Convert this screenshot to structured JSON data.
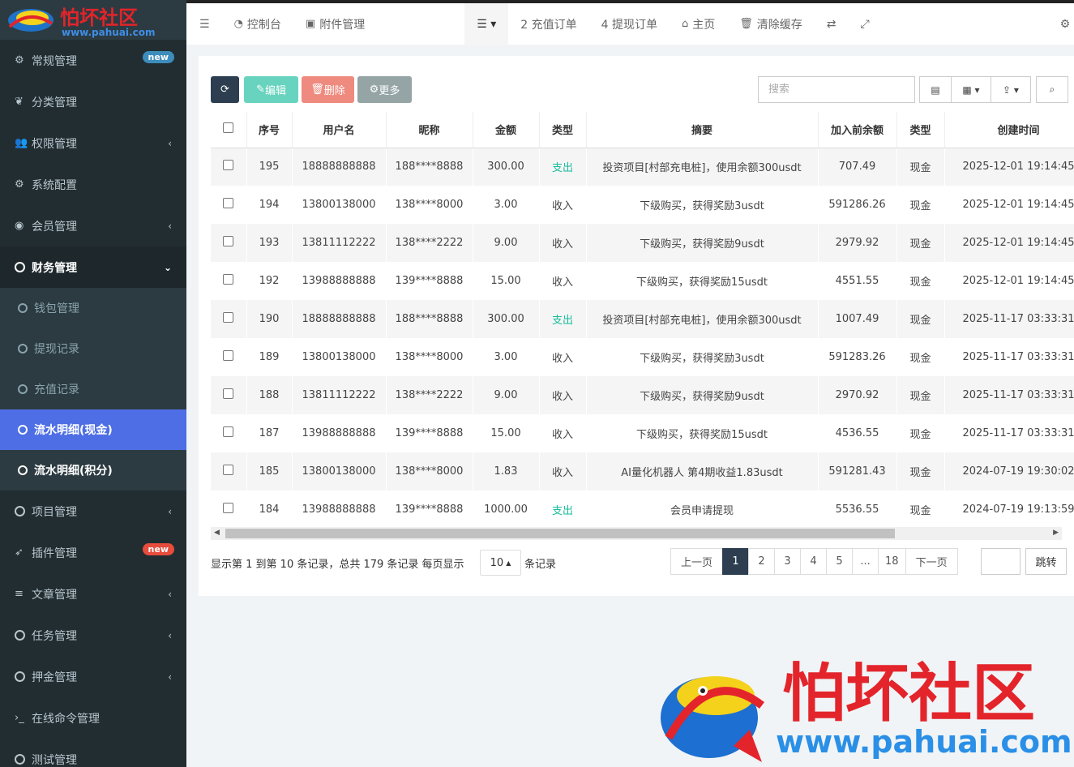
{
  "sidebar": {
    "logo": {
      "text": "怕坏社区",
      "url": "www.pahuai.com"
    },
    "items": [
      {
        "label": "常规管理",
        "icon": "cogs-icon",
        "badge": "new"
      },
      {
        "label": "分类管理",
        "icon": "leaf-icon"
      },
      {
        "label": "权限管理",
        "icon": "group-icon"
      },
      {
        "label": "系统配置",
        "icon": "cog-icon"
      },
      {
        "label": "会员管理",
        "icon": "user-circle-icon"
      },
      {
        "label": "财务管理",
        "icon": "circle-icon"
      },
      {
        "label": "项目管理",
        "icon": "circle-icon"
      },
      {
        "label": "插件管理",
        "icon": "rocket-icon",
        "badge": "new"
      },
      {
        "label": "文章管理",
        "icon": "list-icon"
      },
      {
        "label": "任务管理",
        "icon": "circle-icon"
      },
      {
        "label": "押金管理",
        "icon": "circle-icon"
      },
      {
        "label": "在线命令管理",
        "icon": "terminal-icon"
      },
      {
        "label": "测试管理",
        "icon": "circle-icon"
      }
    ],
    "finance_sub": [
      "钱包管理",
      "提现记录",
      "充值记录",
      "流水明细(现金)",
      "流水明细(积分)"
    ]
  },
  "topbar": {
    "dashboard": "控制台",
    "attachments": "附件管理",
    "recharge": "2 充值订单",
    "withdraw": "4 提现订单",
    "home": "主页",
    "clear_cache": "清除缓存"
  },
  "toolbar": {
    "edit": "编辑",
    "delete": "删除",
    "more": "更多",
    "search_placeholder": "搜索"
  },
  "table": {
    "headers": [
      "序号",
      "用户名",
      "昵称",
      "金额",
      "类型",
      "摘要",
      "加入前余额",
      "类型",
      "创建时间"
    ],
    "rows": [
      [
        "195",
        "18888888888",
        "188****8888",
        "300.00",
        "支出",
        "投资项目[村部充电桩]，使用余额300usdt",
        "707.49",
        "现金",
        "2025-12-01 19:14:45"
      ],
      [
        "194",
        "13800138000",
        "138****8000",
        "3.00",
        "收入",
        "下级购买，获得奖励3usdt",
        "591286.26",
        "现金",
        "2025-12-01 19:14:45"
      ],
      [
        "193",
        "13811112222",
        "138****2222",
        "9.00",
        "收入",
        "下级购买，获得奖励9usdt",
        "2979.92",
        "现金",
        "2025-12-01 19:14:45"
      ],
      [
        "192",
        "13988888888",
        "139****8888",
        "15.00",
        "收入",
        "下级购买，获得奖励15usdt",
        "4551.55",
        "现金",
        "2025-12-01 19:14:45"
      ],
      [
        "190",
        "18888888888",
        "188****8888",
        "300.00",
        "支出",
        "投资项目[村部充电桩]，使用余额300usdt",
        "1007.49",
        "现金",
        "2025-11-17 03:33:31"
      ],
      [
        "189",
        "13800138000",
        "138****8000",
        "3.00",
        "收入",
        "下级购买，获得奖励3usdt",
        "591283.26",
        "现金",
        "2025-11-17 03:33:31"
      ],
      [
        "188",
        "13811112222",
        "138****2222",
        "9.00",
        "收入",
        "下级购买，获得奖励9usdt",
        "2970.92",
        "现金",
        "2025-11-17 03:33:31"
      ],
      [
        "187",
        "13988888888",
        "139****8888",
        "15.00",
        "收入",
        "下级购买，获得奖励15usdt",
        "4536.55",
        "现金",
        "2025-11-17 03:33:31"
      ],
      [
        "185",
        "13800138000",
        "138****8000",
        "1.83",
        "收入",
        "AI量化机器人 第4期收益1.83usdt",
        "591281.43",
        "现金",
        "2024-07-19 19:30:02"
      ],
      [
        "184",
        "13988888888",
        "139****8888",
        "1000.00",
        "支出",
        "会员申请提现",
        "5536.55",
        "现金",
        "2024-07-19 19:13:59"
      ]
    ]
  },
  "pagination": {
    "info": "显示第 1 到第 10 条记录，总共 179 条记录 每页显示",
    "page_size": "10",
    "suffix": "条记录",
    "prev": "上一页",
    "pages": [
      "1",
      "2",
      "3",
      "4",
      "5",
      "...",
      "18"
    ],
    "next": "下一页",
    "jump": "跳转"
  },
  "watermark": {
    "text": "怕坏社区",
    "url": "www.pahuai.com"
  },
  "colors": {
    "sidebar_bg": "#222d32",
    "active_blue": "#4d6ee4",
    "dark_btn": "#2c3e50",
    "edit_green": "#18bc9c",
    "delete_red": "#e74c3c",
    "more_gray": "#95a5a6",
    "expense_green": "#18bc9c",
    "badge_blue": "#3c8dbc",
    "badge_red": "#e74c3c"
  }
}
